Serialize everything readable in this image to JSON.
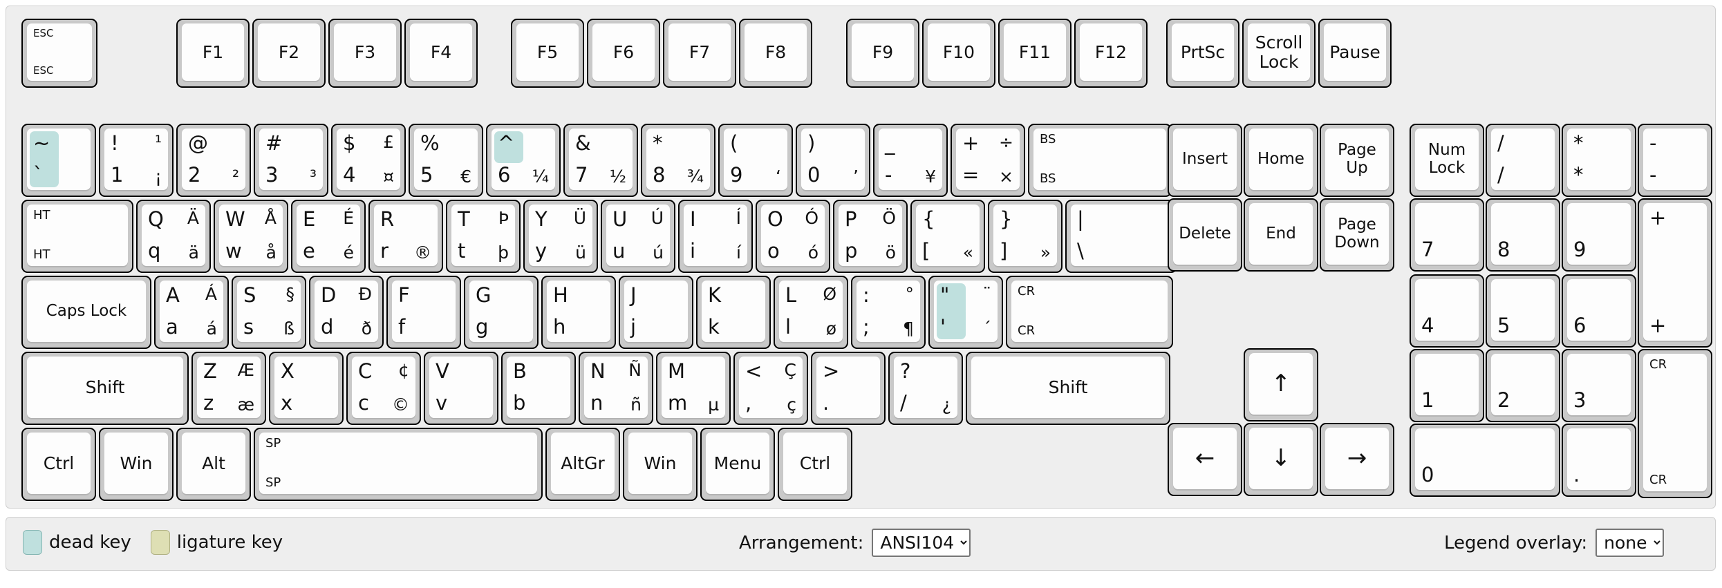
{
  "footer": {
    "dead_key_label": "dead key",
    "ligature_key_label": "ligature key",
    "arrangement_label": "Arrangement:",
    "arrangement_value": "ANSI104",
    "arrangement_options": [
      "ANSI104"
    ],
    "overlay_label": "Legend overlay:",
    "overlay_value": "none",
    "overlay_options": [
      "none"
    ]
  },
  "colors": {
    "dead_key": "#bfe0de",
    "ligature_key": "#dedfb4",
    "key_body": "#c9c9c9",
    "key_cap": "#fdfdfd",
    "panel": "#eeeeee"
  },
  "function_row": {
    "esc": {
      "tl": "ESC",
      "bl": "ESC"
    },
    "f_keys": [
      "F1",
      "F2",
      "F3",
      "F4",
      "F5",
      "F6",
      "F7",
      "F8",
      "F9",
      "F10",
      "F11",
      "F12"
    ],
    "prtsc": "PrtSc",
    "scroll_lock": "Scroll Lock",
    "pause": "Pause"
  },
  "number_row": [
    {
      "name": "backquote",
      "tl": "~",
      "bl": "`",
      "tl_dead": true,
      "bl_dead": true
    },
    {
      "name": "digit1",
      "tl": "!",
      "tr": "¹",
      "bl": "1",
      "br": "¡"
    },
    {
      "name": "digit2",
      "tl": "@",
      "tr": "",
      "bl": "2",
      "br": "²"
    },
    {
      "name": "digit3",
      "tl": "#",
      "tr": "",
      "bl": "3",
      "br": "³"
    },
    {
      "name": "digit4",
      "tl": "$",
      "tr": "£",
      "bl": "4",
      "br": "¤"
    },
    {
      "name": "digit5",
      "tl": "%",
      "tr": "",
      "bl": "5",
      "br": "€"
    },
    {
      "name": "digit6",
      "tl": "^",
      "tr": "",
      "bl": "6",
      "br": "¼",
      "tl_dead": true
    },
    {
      "name": "digit7",
      "tl": "&",
      "tr": "",
      "bl": "7",
      "br": "½"
    },
    {
      "name": "digit8",
      "tl": "*",
      "tr": "",
      "bl": "8",
      "br": "¾"
    },
    {
      "name": "digit9",
      "tl": "(",
      "tr": "",
      "bl": "9",
      "br": "‘"
    },
    {
      "name": "digit0",
      "tl": ")",
      "tr": "",
      "bl": "0",
      "br": "’"
    },
    {
      "name": "minus",
      "tl": "_",
      "tr": "",
      "bl": "-",
      "br": "¥"
    },
    {
      "name": "equal",
      "tl": "+",
      "tr": "÷",
      "bl": "=",
      "br": "×"
    },
    {
      "name": "backspace",
      "tl": "BS",
      "bl": "BS"
    }
  ],
  "top_row": [
    {
      "name": "tab",
      "tl": "HT",
      "bl": "HT"
    },
    {
      "name": "keyq",
      "tl": "Q",
      "tr": "Ä",
      "bl": "q",
      "br": "ä"
    },
    {
      "name": "keyw",
      "tl": "W",
      "tr": "Å",
      "bl": "w",
      "br": "å"
    },
    {
      "name": "keye",
      "tl": "E",
      "tr": "É",
      "bl": "e",
      "br": "é"
    },
    {
      "name": "keyr",
      "tl": "R",
      "tr": "",
      "bl": "r",
      "br": "®"
    },
    {
      "name": "keyt",
      "tl": "T",
      "tr": "Þ",
      "bl": "t",
      "br": "þ"
    },
    {
      "name": "keyy",
      "tl": "Y",
      "tr": "Ü",
      "bl": "y",
      "br": "ü"
    },
    {
      "name": "keyu",
      "tl": "U",
      "tr": "Ú",
      "bl": "u",
      "br": "ú"
    },
    {
      "name": "keyi",
      "tl": "I",
      "tr": "Í",
      "bl": "i",
      "br": "í"
    },
    {
      "name": "keyo",
      "tl": "O",
      "tr": "Ó",
      "bl": "o",
      "br": "ó"
    },
    {
      "name": "keyp",
      "tl": "P",
      "tr": "Ö",
      "bl": "p",
      "br": "ö"
    },
    {
      "name": "bracketleft",
      "tl": "{",
      "tr": "",
      "bl": "[",
      "br": "«"
    },
    {
      "name": "bracketright",
      "tl": "}",
      "tr": "",
      "bl": "]",
      "br": "»"
    },
    {
      "name": "backslash",
      "tl": "|",
      "tr": "",
      "bl": "\\",
      "br": ""
    }
  ],
  "home_row": [
    {
      "name": "capslock",
      "center": "Caps Lock"
    },
    {
      "name": "keya",
      "tl": "A",
      "tr": "Á",
      "bl": "a",
      "br": "á"
    },
    {
      "name": "keys",
      "tl": "S",
      "tr": "§",
      "bl": "s",
      "br": "ß"
    },
    {
      "name": "keyd",
      "tl": "D",
      "tr": "Ð",
      "bl": "d",
      "br": "ð"
    },
    {
      "name": "keyf",
      "tl": "F",
      "tr": "",
      "bl": "f",
      "br": ""
    },
    {
      "name": "keyg",
      "tl": "G",
      "tr": "",
      "bl": "g",
      "br": ""
    },
    {
      "name": "keyh",
      "tl": "H",
      "tr": "",
      "bl": "h",
      "br": ""
    },
    {
      "name": "keyj",
      "tl": "J",
      "tr": "",
      "bl": "j",
      "br": ""
    },
    {
      "name": "keyk",
      "tl": "K",
      "tr": "",
      "bl": "k",
      "br": ""
    },
    {
      "name": "keyl",
      "tl": "L",
      "tr": "Ø",
      "bl": "l",
      "br": "ø"
    },
    {
      "name": "semicolon",
      "tl": ":",
      "tr": "°",
      "bl": ";",
      "br": "¶"
    },
    {
      "name": "quote",
      "tl": "\"",
      "tr": "¨",
      "bl": "'",
      "br": "´",
      "tl_dead": true,
      "bl_dead": true
    },
    {
      "name": "enter",
      "tl": "CR",
      "bl": "CR"
    }
  ],
  "bottom_row": [
    {
      "name": "shift-left",
      "center": "Shift"
    },
    {
      "name": "keyz",
      "tl": "Z",
      "tr": "Æ",
      "bl": "z",
      "br": "æ"
    },
    {
      "name": "keyx",
      "tl": "X",
      "tr": "",
      "bl": "x",
      "br": ""
    },
    {
      "name": "keyc",
      "tl": "C",
      "tr": "¢",
      "bl": "c",
      "br": "©"
    },
    {
      "name": "keyv",
      "tl": "V",
      "tr": "",
      "bl": "v",
      "br": ""
    },
    {
      "name": "keyb",
      "tl": "B",
      "tr": "",
      "bl": "b",
      "br": ""
    },
    {
      "name": "keyn",
      "tl": "N",
      "tr": "Ñ",
      "bl": "n",
      "br": "ñ"
    },
    {
      "name": "keym",
      "tl": "M",
      "tr": "",
      "bl": "m",
      "br": "µ"
    },
    {
      "name": "comma",
      "tl": "<",
      "tr": "Ç",
      "bl": ",",
      "br": "ç"
    },
    {
      "name": "period",
      "tl": ">",
      "tr": "",
      "bl": ".",
      "br": ""
    },
    {
      "name": "slash",
      "tl": "?",
      "tr": "",
      "bl": "/",
      "br": "¿"
    },
    {
      "name": "shift-right",
      "center": "Shift"
    }
  ],
  "modifier_row": [
    {
      "name": "ctrl-left",
      "center": "Ctrl"
    },
    {
      "name": "win-left",
      "center": "Win"
    },
    {
      "name": "alt-left",
      "center": "Alt"
    },
    {
      "name": "space",
      "tl": "SP",
      "bl": "SP"
    },
    {
      "name": "altgr",
      "center": "AltGr"
    },
    {
      "name": "win-right",
      "center": "Win"
    },
    {
      "name": "menu",
      "center": "Menu"
    },
    {
      "name": "ctrl-right",
      "center": "Ctrl"
    }
  ],
  "nav_cluster": {
    "insert": "Insert",
    "home": "Home",
    "page_up": "Page Up",
    "delete": "Delete",
    "end": "End",
    "page_down": "Page Down",
    "arrow_up": "↑",
    "arrow_left": "←",
    "arrow_down": "↓",
    "arrow_right": "→"
  },
  "numpad": [
    {
      "name": "numlock",
      "center": "Num Lock"
    },
    {
      "name": "numpad-divide",
      "tl": "/",
      "bl": "/"
    },
    {
      "name": "numpad-multiply",
      "tl": "*",
      "bl": "*"
    },
    {
      "name": "numpad-subtract",
      "tl": "-",
      "bl": "-"
    },
    {
      "name": "numpad7",
      "bl": "7"
    },
    {
      "name": "numpad8",
      "bl": "8"
    },
    {
      "name": "numpad9",
      "bl": "9"
    },
    {
      "name": "numpad-add",
      "tl": "+",
      "bl": "+"
    },
    {
      "name": "numpad4",
      "bl": "4"
    },
    {
      "name": "numpad5",
      "bl": "5"
    },
    {
      "name": "numpad6",
      "bl": "6"
    },
    {
      "name": "numpad1",
      "bl": "1"
    },
    {
      "name": "numpad2",
      "bl": "2"
    },
    {
      "name": "numpad3",
      "bl": "3"
    },
    {
      "name": "numpad-enter",
      "tl": "CR",
      "bl": "CR"
    },
    {
      "name": "numpad0",
      "bl": "0"
    },
    {
      "name": "numpad-decimal",
      "bl": "."
    }
  ]
}
